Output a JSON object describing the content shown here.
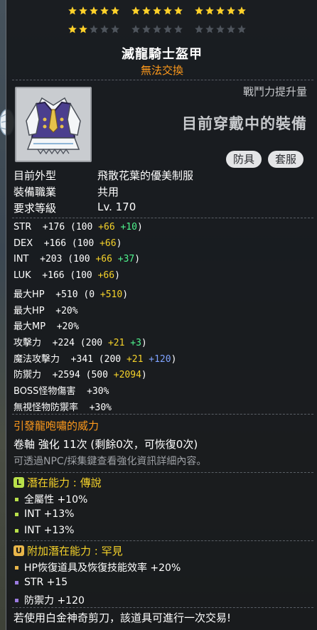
{
  "stars": {
    "groups": [
      {
        "filled": 5,
        "total": 5
      },
      {
        "filled": 5,
        "total": 5
      },
      {
        "filled": 5,
        "total": 5
      },
      {
        "filled": 2,
        "total": 5
      },
      {
        "filled": 0,
        "total": 5
      },
      {
        "filled": 0,
        "total": 5
      }
    ],
    "color_on": "#ffd12a",
    "color_off": "#4e545c"
  },
  "item": {
    "name": "滅龍騎士盔甲",
    "tradeability": "無法交換",
    "power_label": "戰鬥力提升量",
    "equipped_text": "目前穿戴中的裝備",
    "tags": [
      "防具",
      "套服"
    ],
    "icon": "uniform-outfit-icon"
  },
  "info": [
    {
      "label": "目前外型",
      "value": "飛散花葉的優美制服"
    },
    {
      "label": "裝備職業",
      "value": "共用"
    },
    {
      "label": "要求等級",
      "value": "Lv. 170"
    }
  ],
  "stats": [
    {
      "name": "STR",
      "total": "+176",
      "base": "100",
      "flame": "+66",
      "extra": "+10",
      "extra_color": "green"
    },
    {
      "name": "DEX",
      "total": "+166",
      "base": "100",
      "flame": "+66",
      "extra": "",
      "extra_color": ""
    },
    {
      "name": "INT",
      "total": "+203",
      "base": "100",
      "flame": "+66",
      "extra": "+37",
      "extra_color": "green"
    },
    {
      "name": "LUK",
      "total": "+166",
      "base": "100",
      "flame": "+66",
      "extra": "",
      "extra_color": ""
    },
    {
      "name": "最大HP",
      "total": "+510",
      "base": "0",
      "flame": "+510",
      "extra": "",
      "extra_color": ""
    },
    {
      "name": "最大HP",
      "total": "+20%",
      "simple": true
    },
    {
      "name": "最大MP",
      "total": "+20%",
      "simple": true
    },
    {
      "name": "攻擊力",
      "total": "+224",
      "base": "200",
      "flame": "+21",
      "extra": "+3",
      "extra_color": "green"
    },
    {
      "name": "魔法攻擊力",
      "total": "+341",
      "base": "200",
      "flame": "+21",
      "extra": "+120",
      "extra_color": "blue"
    },
    {
      "name": "防禦力",
      "total": "+2594",
      "base": "500",
      "flame": "+2094",
      "extra": "",
      "extra_color": ""
    },
    {
      "name": "BOSS怪物傷害",
      "total": "+30%",
      "simple": true
    },
    {
      "name": "無視怪物防禦率",
      "total": "+30%",
      "simple": true
    }
  ],
  "flame_title": "引發龍咆嘯的威力",
  "scroll_line": "卷軸 強化 11次 (剩餘0次，可恢復0次)",
  "npc_line": "可透過NPC/採集鍵查看強化資訊詳細內容。",
  "potential": {
    "badge": "L",
    "badge_color": "#b8e04a",
    "title": "潛在能力 : 傳說",
    "lines": [
      "全屬性 +10%",
      "INT +13%",
      "INT +13%"
    ],
    "bullet_color": "#b8e04a"
  },
  "bonus_potential": {
    "badge": "U",
    "badge_color": "#e8b64a",
    "title": "附加潛在能力 : 罕見",
    "lines": [
      {
        "text": "HP恢復道具及恢復技能效率 +20%",
        "bullet_color": "#e8b64a"
      },
      {
        "text": "STR +15",
        "bullet_color": "#9b7be0"
      },
      {
        "text": "防禦力 +120",
        "bullet_color": "#9b7be0"
      }
    ]
  },
  "footer": "若使用白金神奇剪刀，該道具可進行一次交易!"
}
